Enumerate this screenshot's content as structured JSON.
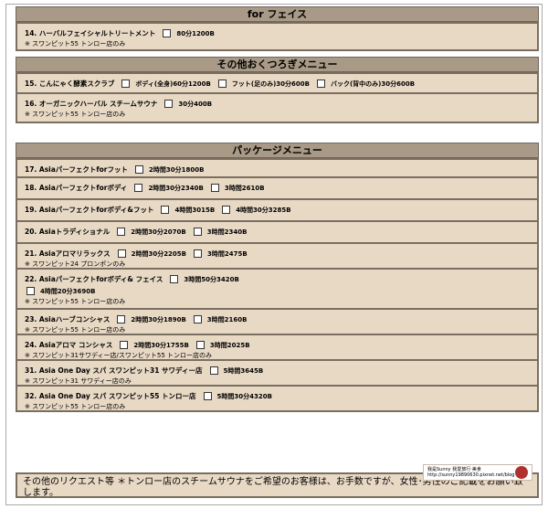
{
  "sections": [
    {
      "heading": "for フェイス",
      "items": [
        {
          "num": "14.",
          "name": "ハーバルフェイシャルトリートメント",
          "note": "※ スワンピット55 トンロー店のみ",
          "options": [
            "80分1200B"
          ]
        }
      ]
    },
    {
      "heading": "その他おくつろぎメニュー",
      "items": [
        {
          "num": "15.",
          "name": "こんにゃく酵素スクラブ",
          "note": "",
          "options": [
            "ボディ(全身)60分1200B",
            "フット(足のみ)30分600B",
            "バック(背中のみ)30分600B"
          ]
        },
        {
          "num": "16.",
          "name": "オーガニックハーバル スチームサウナ",
          "note": "※ スワンピット55 トンロー店のみ",
          "options": [
            "30分400B"
          ]
        }
      ]
    },
    {
      "heading": "パッケージメニュー",
      "items": [
        {
          "num": "17.",
          "name": "Asiaパーフェクトforフット",
          "note": "",
          "options": [
            "2時間30分1800B"
          ]
        },
        {
          "num": "18.",
          "name": "Asiaパーフェクトforボディ",
          "note": "",
          "options": [
            "2時間30分2340B",
            "3時間2610B"
          ]
        },
        {
          "num": "19.",
          "name": "Asiaパーフェクトforボディ&フット",
          "note": "",
          "options": [
            "4時間3015B",
            "4時間30分3285B"
          ]
        },
        {
          "num": "20.",
          "name": "Asiaトラディショナル",
          "note": "",
          "options": [
            "2時間30分2070B",
            "3時間2340B"
          ]
        },
        {
          "num": "21.",
          "name": "Asiaアロマリラックス",
          "note": "※ スワンピット24 プロンポンのみ",
          "options": [
            "2時間30分2205B",
            "3時間2475B"
          ]
        },
        {
          "num": "22.",
          "name": "Asiaパーフェクトforボディ& フェイス",
          "note": "※ スワンピット55 トンロー店のみ",
          "options": [
            "3時間50分3420B"
          ],
          "options2": [
            "4時間20分3690B"
          ]
        },
        {
          "num": "23.",
          "name": "Asiaハーブコンシャス",
          "note": "※ スワンピット55 トンロー店のみ",
          "options": [
            "2時間30分1890B",
            "3時間2160B"
          ]
        },
        {
          "num": "24.",
          "name": "Asiaアロマ コンシャス",
          "note": "※ スワンピット31サワディー店/スワンピット55 トンロー店のみ",
          "options": [
            "2時間30分1755B",
            "3時間2025B"
          ]
        },
        {
          "num": "31.",
          "name": "Asia One Day スパ スワンピット31 サワディー店",
          "note": "※ スワンピット31 サワディー店のみ",
          "options": [
            "5時間3645B"
          ]
        },
        {
          "num": "32.",
          "name": "Asia One Day スパ スワンピット55 トンロー店",
          "note": "※ スワンピット55 トンロー店のみ",
          "options": [
            "5時間30分4320B"
          ]
        }
      ]
    }
  ],
  "footer": {
    "text": "その他のリクエスト等 ＊トンロー店のスチームサウナをご希望のお客様は、お手数ですが、女性･男性のご記載をお願い致します。"
  },
  "stamp": {
    "line1": "我是Sunny 我愛旅行‧美食",
    "line2": "http://sunny19890630.pixnet.net/blog"
  },
  "colors": {
    "section_header": "#a89a86",
    "row_bg": "#e8d9c5",
    "border": "#7a6e60"
  }
}
